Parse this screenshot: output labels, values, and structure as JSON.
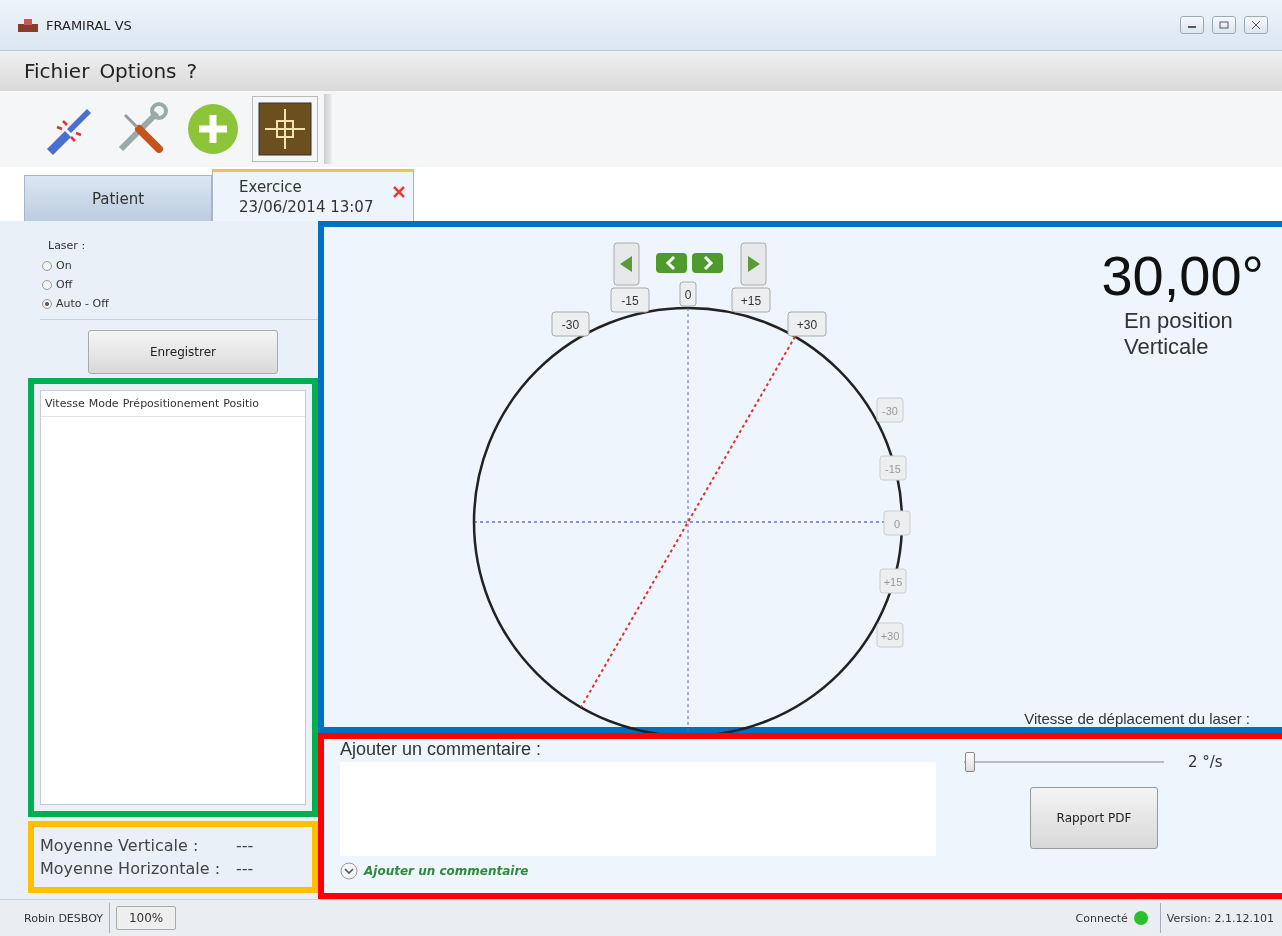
{
  "window": {
    "title": "FRAMIRAL VS"
  },
  "menu": [
    "Fichier",
    "Options",
    "?"
  ],
  "tabs": [
    {
      "label": "Patient",
      "selected": false
    },
    {
      "label": "Exercice",
      "subtitle": "23/06/2014 13:07",
      "selected": true,
      "closable": true
    }
  ],
  "laser": {
    "label": "Laser :",
    "options": [
      {
        "label": "On",
        "selected": false
      },
      {
        "label": "Off",
        "selected": false
      },
      {
        "label": "Auto - Off",
        "selected": true
      }
    ]
  },
  "record_button": "Enregistrer",
  "results_list": {
    "columns": [
      "Vitesse",
      "Mode",
      "Prépositionement",
      "Positio"
    ]
  },
  "averages": {
    "rows": [
      {
        "label": "Moyenne Verticale :",
        "value": "---"
      },
      {
        "label": "Moyenne Horizontale :",
        "value": "---"
      }
    ]
  },
  "gauge_panel": {
    "top_ticks": [
      "-30",
      "-15",
      "0",
      "+15",
      "+30"
    ],
    "right_ticks": [
      "-30",
      "-15",
      "0",
      "+15",
      "+30"
    ],
    "reading": "30,00°",
    "status": "En position Verticale",
    "speed_label": "Vitesse de déplacement du laser :"
  },
  "comment_panel": {
    "label": "Ajouter un commentaire :",
    "expander": "Ajouter un commentaire",
    "expanded": false,
    "speed": {
      "level": 0.03,
      "reading": "2 °/s"
    },
    "pdf_button": "Rapport PDF"
  },
  "status_bar": {
    "user": "Robin DESBOY",
    "zoom": "100%",
    "connection": "Connecté",
    "connected": true,
    "version": "Version: 2.1.12.101"
  }
}
